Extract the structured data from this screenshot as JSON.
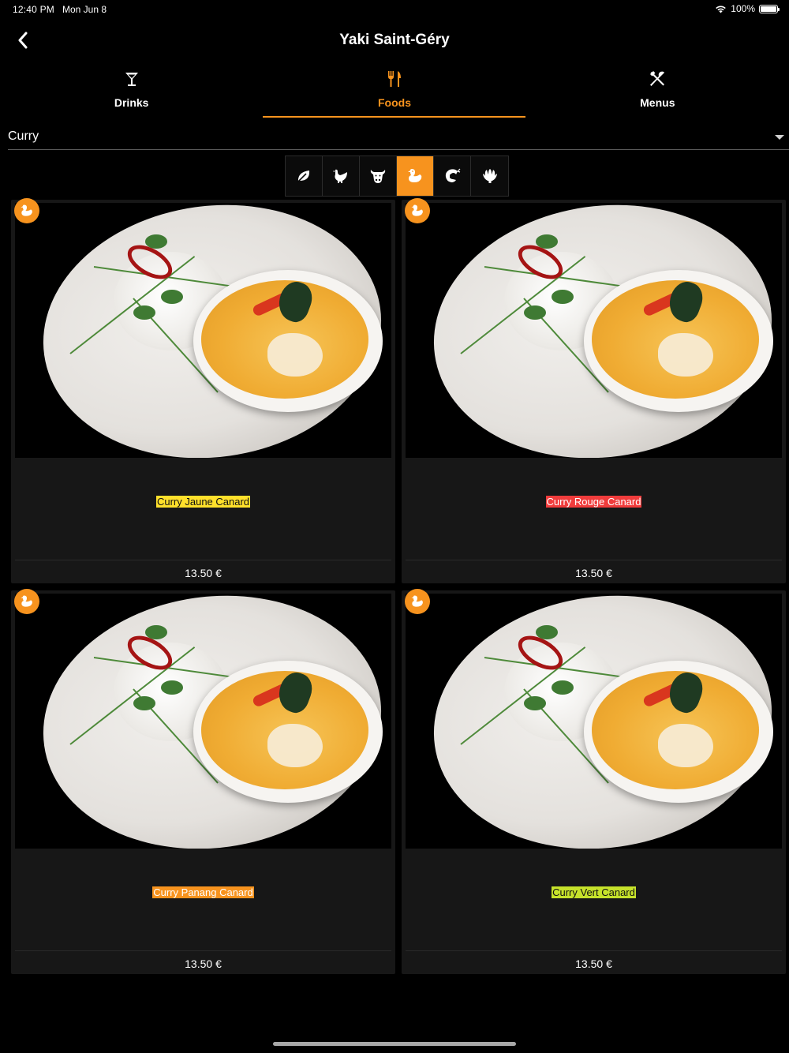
{
  "status_bar": {
    "time": "12:40 PM",
    "date": "Mon Jun 8",
    "battery": "100%"
  },
  "nav": {
    "title": "Yaki Saint-Géry",
    "back_icon": "chevron-left-icon"
  },
  "tabs": [
    {
      "label": "Drinks",
      "icon": "cocktail-glass-icon",
      "active": false
    },
    {
      "label": "Foods",
      "icon": "fork-knife-icon",
      "active": true
    },
    {
      "label": "Menus",
      "icon": "crossed-utensils-icon",
      "active": false
    }
  ],
  "category": {
    "value": "Curry"
  },
  "filters": [
    {
      "icon": "leaf-icon",
      "active": false
    },
    {
      "icon": "chicken-icon",
      "active": false
    },
    {
      "icon": "beef-icon",
      "active": false
    },
    {
      "icon": "duck-icon",
      "active": true
    },
    {
      "icon": "shrimp-icon",
      "active": false
    },
    {
      "icon": "seafood-shell-icon",
      "active": false
    }
  ],
  "items": [
    {
      "name": "Curry Jaune Canard",
      "price": "13.50 €",
      "label_color": "#ffe02b",
      "badge_icon": "duck-icon"
    },
    {
      "name": "Curry Rouge Canard",
      "price": "13.50 €",
      "label_color": "#f03c3c",
      "badge_icon": "duck-icon"
    },
    {
      "name": "Curry Panang Canard",
      "price": "13.50 €",
      "label_color": "#f7931e",
      "badge_icon": "duck-icon"
    },
    {
      "name": "Curry Vert Canard",
      "price": "13.50 €",
      "label_color": "#c6e22b",
      "badge_icon": "duck-icon"
    }
  ],
  "colors": {
    "accent": "#f7931e",
    "background": "#000000",
    "card": "#171717"
  }
}
